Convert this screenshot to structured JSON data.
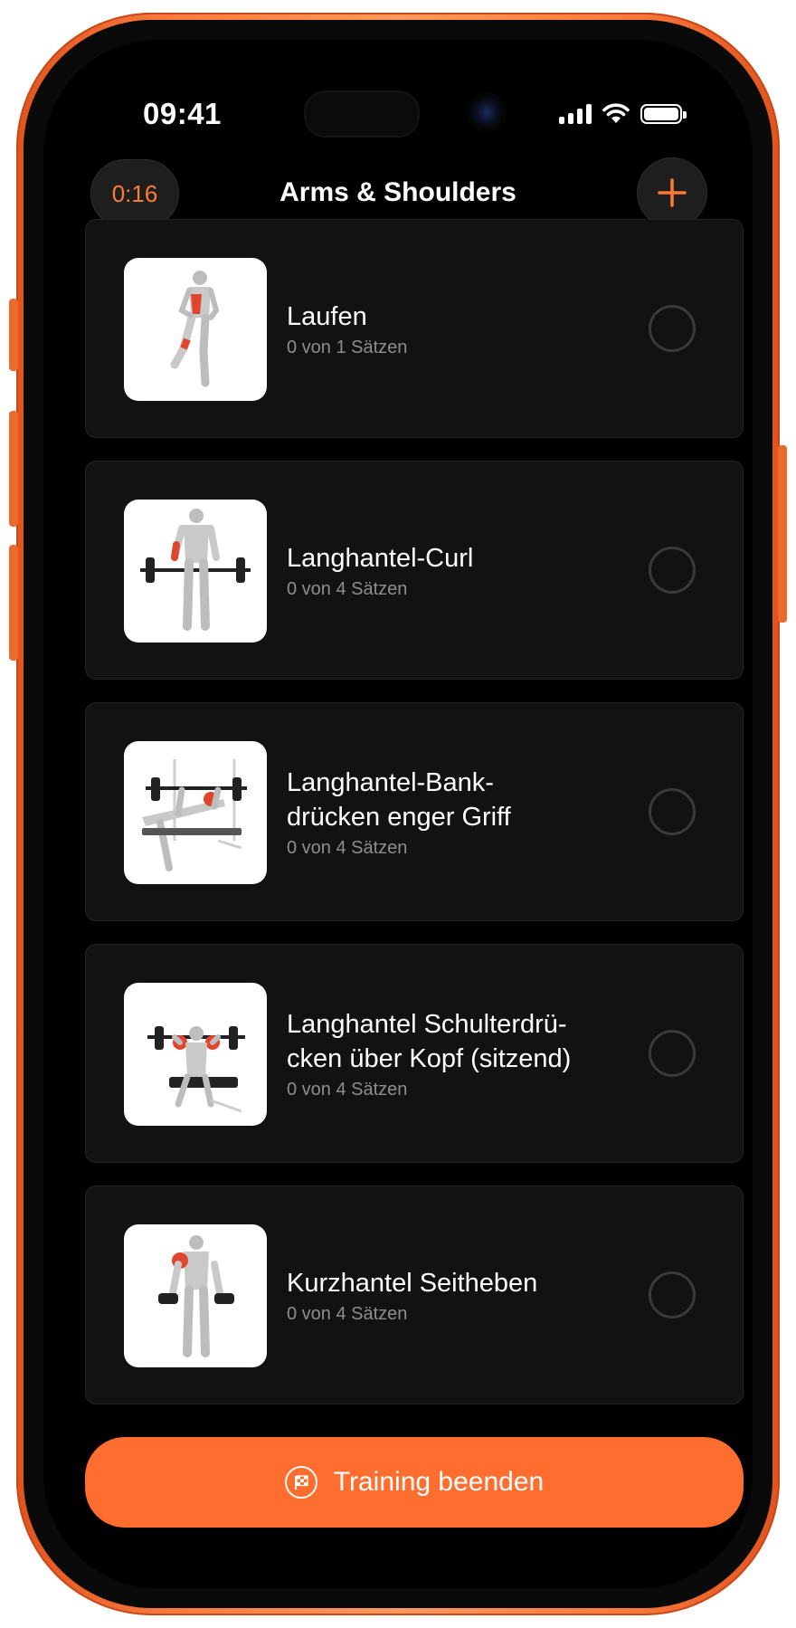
{
  "status_bar": {
    "time": "09:41",
    "icons": [
      "cellular-signal-icon",
      "wifi-icon",
      "battery-icon"
    ]
  },
  "header": {
    "timer": "0:16",
    "title": "Arms & Shoulders",
    "add_icon": "plus-icon"
  },
  "exercises": [
    {
      "name": "Laufen",
      "sets": "0 von 1 Sätzen"
    },
    {
      "name": "Langhantel-Curl",
      "sets": "0 von 4 Sätzen"
    },
    {
      "name": "Langhantel-Bank-\ndrücken enger Griff",
      "sets": "0 von 4 Sätzen"
    },
    {
      "name": "Langhantel Schulterdrü-\ncken über Kopf (sitzend)",
      "sets": "0 von 4 Sätzen"
    },
    {
      "name": "Kurzhantel Seitheben",
      "sets": "0 von 4 Sätzen"
    }
  ],
  "footer": {
    "finish_label": "Training beenden",
    "finish_icon": "finish-flag-icon"
  },
  "colors": {
    "accent": "#ff6e2e",
    "background": "#000000",
    "card": "#121212",
    "muscle_highlight": "#e0452e"
  }
}
